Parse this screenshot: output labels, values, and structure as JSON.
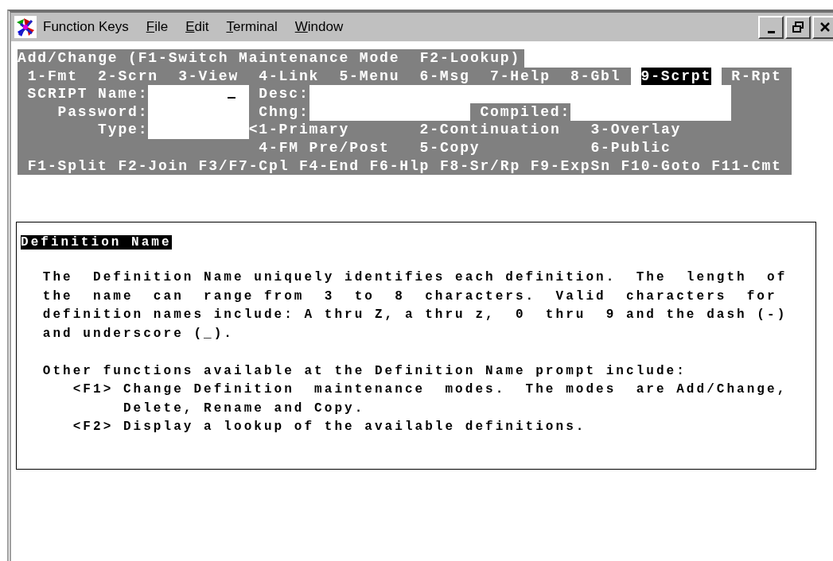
{
  "window": {
    "menu": [
      {
        "label": "Function Keys",
        "mnemonic": false
      },
      {
        "label": "File",
        "mnemonic": true
      },
      {
        "label": "Edit",
        "mnemonic": true
      },
      {
        "label": "Terminal",
        "mnemonic": true
      },
      {
        "label": "Window",
        "mnemonic": true
      }
    ]
  },
  "terminal": {
    "mode_title": "Add/Change (F1-Switch Maintenance Mode  F2-Lookup)",
    "tabs": [
      {
        "label": "1-Fmt",
        "selected": false
      },
      {
        "label": "2-Scrn",
        "selected": false
      },
      {
        "label": "3-View",
        "selected": false
      },
      {
        "label": "4-Link",
        "selected": false
      },
      {
        "label": "5-Menu",
        "selected": false
      },
      {
        "label": "6-Msg",
        "selected": false
      },
      {
        "label": "7-Help",
        "selected": false
      },
      {
        "label": "8-Gbl",
        "selected": false
      },
      {
        "label": "9-Scrpt",
        "selected": true
      },
      {
        "label": "R-Rpt",
        "selected": false
      }
    ],
    "script_name": {
      "label": "SCRIPT Name:"
    },
    "password": {
      "label": "Password:"
    },
    "type": {
      "label": "Type:",
      "marker": "<",
      "options": [
        "1-Primary",
        "2-Continuation",
        "3-Overlay",
        "4-FM Pre/Post",
        "5-Copy",
        "6-Public"
      ]
    },
    "desc": {
      "label": "Desc:"
    },
    "chng": {
      "label": "Chng:"
    },
    "compiled": {
      "label": "Compiled:"
    },
    "function_keys": [
      "F1-Split",
      "F2-Join",
      "F3/F7-Cpl",
      "F4-End",
      "F6-Hlp",
      "F8-Sr/Rp",
      "F9-ExpSn",
      "F10-Goto",
      "F11-Cmt"
    ]
  },
  "help": {
    "title": "Definition Name",
    "paragraphs": [
      "The  Definition Name uniquely identifies each definition.  The  length  of\nthe  name  can  range from  3  to  8  characters.  Valid  characters  for\ndefinition names include: A thru Z, a thru z,  0  thru  9 and the dash (-)\nand underscore (_).",
      "Other functions available at the Definition Name prompt include:\n   <F1> Change Definition  maintenance  modes.  The modes  are Add/Change,\n        Delete, Rename and Copy.\n   <F2> Display a lookup of the available definitions."
    ]
  }
}
